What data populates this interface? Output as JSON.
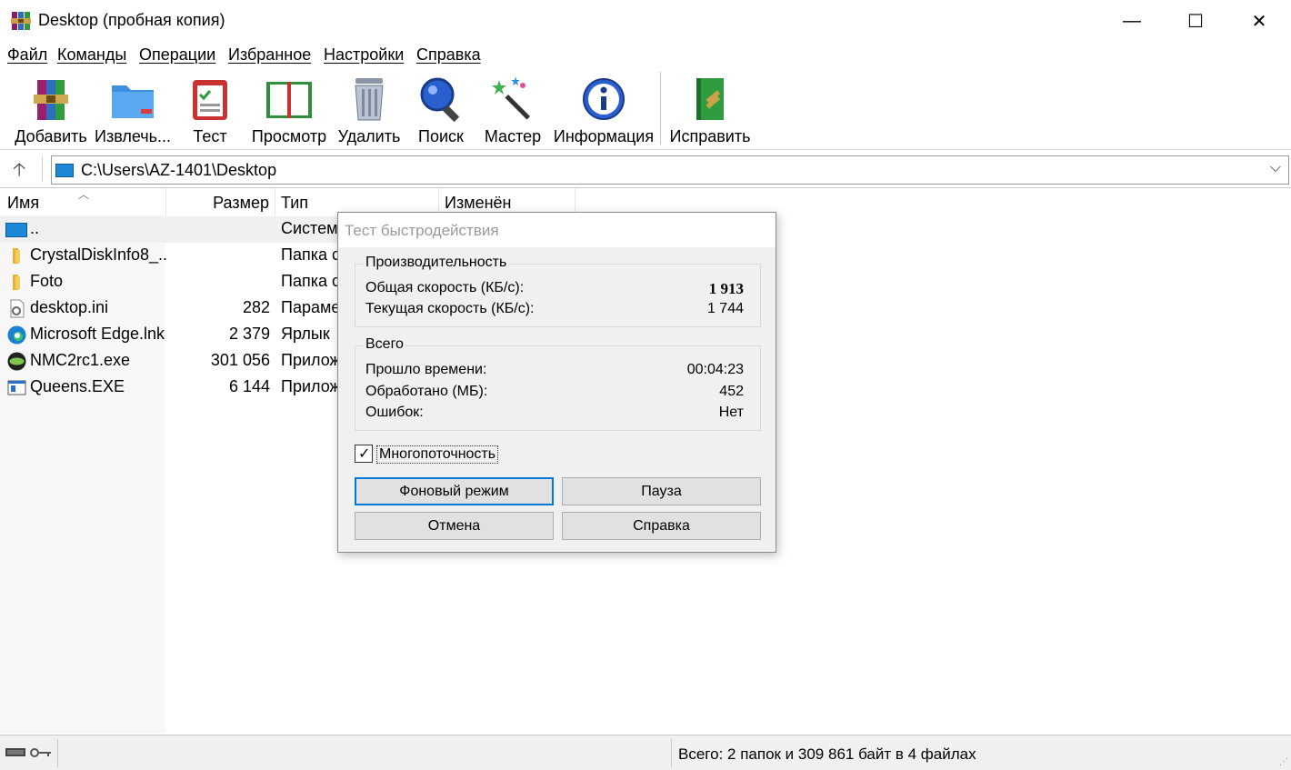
{
  "window": {
    "title": "Desktop (пробная копия)",
    "min_glyph": "—",
    "max_glyph": "☐",
    "close_glyph": "✕"
  },
  "menu": [
    {
      "label": "Файл"
    },
    {
      "label": "Команды"
    },
    {
      "label": "Операции"
    },
    {
      "label": "Избранное"
    },
    {
      "label": "Настройки"
    },
    {
      "label": "Справка"
    }
  ],
  "toolbar": [
    {
      "label": "Добавить",
      "icon": "archive-add-icon"
    },
    {
      "label": "Извлечь...",
      "icon": "extract-folder-icon"
    },
    {
      "label": "Тест",
      "icon": "test-checklist-icon"
    },
    {
      "label": "Просмотр",
      "icon": "view-book-icon"
    },
    {
      "label": "Удалить",
      "icon": "trash-icon"
    },
    {
      "label": "Поиск",
      "icon": "search-magnifier-icon"
    },
    {
      "label": "Мастер",
      "icon": "wizard-wand-icon"
    },
    {
      "label": "Информация",
      "icon": "info-icon"
    },
    {
      "label": "Исправить",
      "icon": "repair-book-icon"
    }
  ],
  "address": {
    "path": "C:\\Users\\AZ-1401\\Desktop",
    "up_glyph": "🡡",
    "dropdown_glyph": "⌵"
  },
  "columns": {
    "name": "Имя",
    "size": "Размер",
    "type": "Тип",
    "modified": "Изменён",
    "sort_glyph": "︿"
  },
  "files": [
    {
      "name": "..",
      "size": "",
      "type": "Системн",
      "icon": "drive-icon"
    },
    {
      "name": "CrystalDiskInfo8_...",
      "size": "",
      "type": "Папка с",
      "icon": "folder-icon"
    },
    {
      "name": "Foto",
      "size": "",
      "type": "Папка с",
      "icon": "folder-icon"
    },
    {
      "name": "desktop.ini",
      "size": "282",
      "type": "Параме",
      "icon": "settings-file-icon"
    },
    {
      "name": "Microsoft Edge.lnk",
      "size": "2 379",
      "type": "Ярлык",
      "icon": "edge-icon"
    },
    {
      "name": "NMC2rc1.exe",
      "size": "301 056",
      "type": "Прилож",
      "icon": "exe-app-icon"
    },
    {
      "name": "Queens.EXE",
      "size": "6 144",
      "type": "Прилож",
      "icon": "window-app-icon"
    }
  ],
  "dialog": {
    "title": "Тест быстродействия",
    "performance": {
      "title": "Производительность",
      "total_speed_label": "Общая скорость (КБ/с):",
      "total_speed_value": "1 913",
      "current_speed_label": "Текущая скорость (КБ/с):",
      "current_speed_value": "1 744"
    },
    "totals": {
      "title": "Всего",
      "elapsed_label": "Прошло времени:",
      "elapsed_value": "00:04:23",
      "processed_label": "Обработано (МБ):",
      "processed_value": "452",
      "errors_label": "Ошибок:",
      "errors_value": "Нет"
    },
    "multithread_label": "Многопоточность",
    "multithread_checked": true,
    "btn_background": "Фоновый режим",
    "btn_pause": "Пауза",
    "btn_cancel": "Отмена",
    "btn_help": "Справка"
  },
  "status": {
    "summary": "Всего: 2 папок и 309 861 байт в 4 файлах"
  }
}
